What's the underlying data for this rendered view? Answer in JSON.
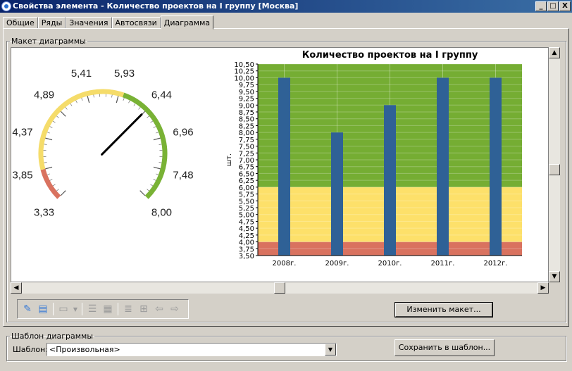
{
  "window": {
    "title": "Свойства элемента - Количество проектов на I группу [Москва]",
    "minimize": "_",
    "maximize": "□",
    "close": "X"
  },
  "tabs": [
    "Общие",
    "Ряды",
    "Значения",
    "Автосвязи",
    "Диаграмма"
  ],
  "layout_group": {
    "legend": "Макет диаграммы"
  },
  "gauge": {
    "min": 3.33,
    "max": 8.0,
    "value": 6.44,
    "tick_labels": [
      "3,33",
      "3,85",
      "4,37",
      "4,89",
      "5,41",
      "5,93",
      "6,44",
      "6,96",
      "7,48",
      "8,00"
    ],
    "bands": [
      {
        "from": 3.33,
        "to": 3.85,
        "color": "#d9725f"
      },
      {
        "from": 3.85,
        "to": 6.0,
        "color": "#f5dc6a"
      },
      {
        "from": 6.0,
        "to": 8.0,
        "color": "#79b235"
      }
    ]
  },
  "chart_data": {
    "type": "bar",
    "title": "Количество проектов на I группу",
    "ylabel": "шт.",
    "categories": [
      "2008г.",
      "2009г.",
      "2010г.",
      "2011г.",
      "2012г."
    ],
    "values": [
      10.0,
      8.0,
      9.0,
      10.0,
      10.0
    ],
    "ylim": [
      3.5,
      10.5
    ],
    "yticks": [
      "3,50",
      "3,75",
      "4,00",
      "4,25",
      "4,50",
      "4,75",
      "5,00",
      "5,25",
      "5,50",
      "5,75",
      "6,00",
      "6,25",
      "6,50",
      "6,75",
      "7,00",
      "7,25",
      "7,50",
      "7,75",
      "8,00",
      "8,25",
      "8,50",
      "8,75",
      "9,00",
      "9,25",
      "9,50",
      "9,75",
      "10,00",
      "10,25",
      "10,50"
    ],
    "bands": [
      {
        "from": 3.5,
        "to": 4.0,
        "color": "#d9725f"
      },
      {
        "from": 4.0,
        "to": 6.0,
        "color": "#fde06a"
      },
      {
        "from": 6.0,
        "to": 10.5,
        "color": "#75ad33"
      }
    ],
    "bar_color": "#2f6196",
    "grid": true
  },
  "buttons": {
    "change_layout": "Изменить макет...",
    "save_template": "Сохранить в шаблон..."
  },
  "template_group": {
    "legend": "Шаблон диаграммы",
    "label": "Шаблон:",
    "value": "<Произвольная>"
  }
}
